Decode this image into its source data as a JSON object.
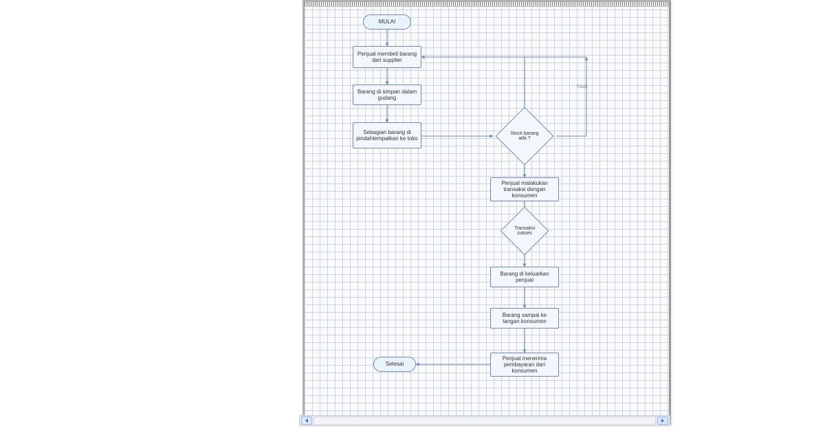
{
  "flow": {
    "start": "MULAI",
    "end": "Selesai",
    "p_buy": "Penjual membeli barang dari supplier",
    "p_store": "Barang di simpan dalam gudang",
    "p_move": "Sebagian barang di pindahtempatkan ke toko",
    "d_stock": "Stock barang ada ?",
    "d_stock_no": "Tidak",
    "p_trans": "Penjual malakukan transaksi dengan konsumen",
    "d_trans_ok": "Transaksi sukses",
    "p_out": "Barang di keluarkan penjual",
    "p_deliver": "Barang sampai ke tangan konsumen",
    "p_pay": "Penjual menerima pembayaran dari konsumen"
  },
  "ui": {
    "scroll_left": "scroll-left",
    "scroll_right": "scroll-right"
  }
}
